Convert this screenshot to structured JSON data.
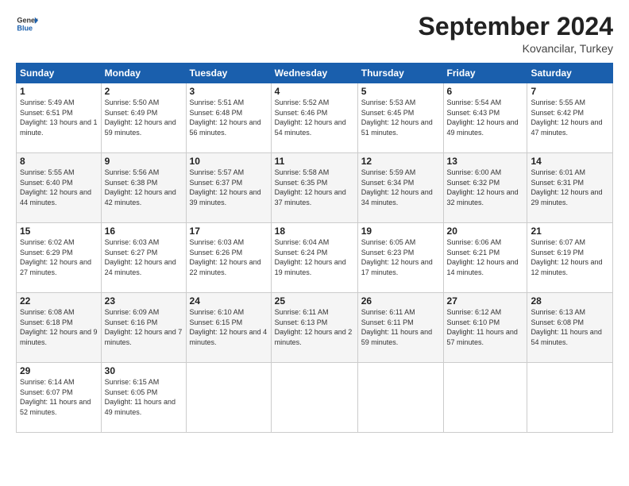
{
  "header": {
    "logo_general": "General",
    "logo_blue": "Blue",
    "month_title": "September 2024",
    "location": "Kovancilar, Turkey"
  },
  "days_of_week": [
    "Sunday",
    "Monday",
    "Tuesday",
    "Wednesday",
    "Thursday",
    "Friday",
    "Saturday"
  ],
  "weeks": [
    [
      {
        "day": "1",
        "sunrise": "5:49 AM",
        "sunset": "6:51 PM",
        "daylight": "13 hours and 1 minute."
      },
      {
        "day": "2",
        "sunrise": "5:50 AM",
        "sunset": "6:49 PM",
        "daylight": "12 hours and 59 minutes."
      },
      {
        "day": "3",
        "sunrise": "5:51 AM",
        "sunset": "6:48 PM",
        "daylight": "12 hours and 56 minutes."
      },
      {
        "day": "4",
        "sunrise": "5:52 AM",
        "sunset": "6:46 PM",
        "daylight": "12 hours and 54 minutes."
      },
      {
        "day": "5",
        "sunrise": "5:53 AM",
        "sunset": "6:45 PM",
        "daylight": "12 hours and 51 minutes."
      },
      {
        "day": "6",
        "sunrise": "5:54 AM",
        "sunset": "6:43 PM",
        "daylight": "12 hours and 49 minutes."
      },
      {
        "day": "7",
        "sunrise": "5:55 AM",
        "sunset": "6:42 PM",
        "daylight": "12 hours and 47 minutes."
      }
    ],
    [
      {
        "day": "8",
        "sunrise": "5:55 AM",
        "sunset": "6:40 PM",
        "daylight": "12 hours and 44 minutes."
      },
      {
        "day": "9",
        "sunrise": "5:56 AM",
        "sunset": "6:38 PM",
        "daylight": "12 hours and 42 minutes."
      },
      {
        "day": "10",
        "sunrise": "5:57 AM",
        "sunset": "6:37 PM",
        "daylight": "12 hours and 39 minutes."
      },
      {
        "day": "11",
        "sunrise": "5:58 AM",
        "sunset": "6:35 PM",
        "daylight": "12 hours and 37 minutes."
      },
      {
        "day": "12",
        "sunrise": "5:59 AM",
        "sunset": "6:34 PM",
        "daylight": "12 hours and 34 minutes."
      },
      {
        "day": "13",
        "sunrise": "6:00 AM",
        "sunset": "6:32 PM",
        "daylight": "12 hours and 32 minutes."
      },
      {
        "day": "14",
        "sunrise": "6:01 AM",
        "sunset": "6:31 PM",
        "daylight": "12 hours and 29 minutes."
      }
    ],
    [
      {
        "day": "15",
        "sunrise": "6:02 AM",
        "sunset": "6:29 PM",
        "daylight": "12 hours and 27 minutes."
      },
      {
        "day": "16",
        "sunrise": "6:03 AM",
        "sunset": "6:27 PM",
        "daylight": "12 hours and 24 minutes."
      },
      {
        "day": "17",
        "sunrise": "6:03 AM",
        "sunset": "6:26 PM",
        "daylight": "12 hours and 22 minutes."
      },
      {
        "day": "18",
        "sunrise": "6:04 AM",
        "sunset": "6:24 PM",
        "daylight": "12 hours and 19 minutes."
      },
      {
        "day": "19",
        "sunrise": "6:05 AM",
        "sunset": "6:23 PM",
        "daylight": "12 hours and 17 minutes."
      },
      {
        "day": "20",
        "sunrise": "6:06 AM",
        "sunset": "6:21 PM",
        "daylight": "12 hours and 14 minutes."
      },
      {
        "day": "21",
        "sunrise": "6:07 AM",
        "sunset": "6:19 PM",
        "daylight": "12 hours and 12 minutes."
      }
    ],
    [
      {
        "day": "22",
        "sunrise": "6:08 AM",
        "sunset": "6:18 PM",
        "daylight": "12 hours and 9 minutes."
      },
      {
        "day": "23",
        "sunrise": "6:09 AM",
        "sunset": "6:16 PM",
        "daylight": "12 hours and 7 minutes."
      },
      {
        "day": "24",
        "sunrise": "6:10 AM",
        "sunset": "6:15 PM",
        "daylight": "12 hours and 4 minutes."
      },
      {
        "day": "25",
        "sunrise": "6:11 AM",
        "sunset": "6:13 PM",
        "daylight": "12 hours and 2 minutes."
      },
      {
        "day": "26",
        "sunrise": "6:11 AM",
        "sunset": "6:11 PM",
        "daylight": "11 hours and 59 minutes."
      },
      {
        "day": "27",
        "sunrise": "6:12 AM",
        "sunset": "6:10 PM",
        "daylight": "11 hours and 57 minutes."
      },
      {
        "day": "28",
        "sunrise": "6:13 AM",
        "sunset": "6:08 PM",
        "daylight": "11 hours and 54 minutes."
      }
    ],
    [
      {
        "day": "29",
        "sunrise": "6:14 AM",
        "sunset": "6:07 PM",
        "daylight": "11 hours and 52 minutes."
      },
      {
        "day": "30",
        "sunrise": "6:15 AM",
        "sunset": "6:05 PM",
        "daylight": "11 hours and 49 minutes."
      },
      null,
      null,
      null,
      null,
      null
    ]
  ]
}
